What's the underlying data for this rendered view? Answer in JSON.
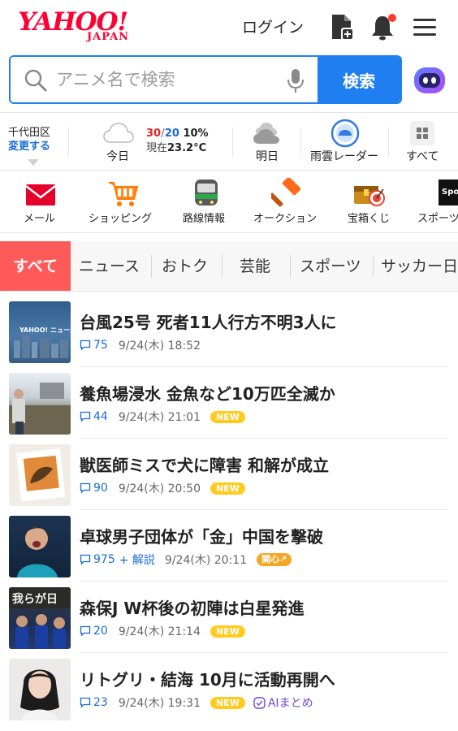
{
  "header": {
    "logo_main": "YAHOO!",
    "logo_sub": "JAPAN",
    "login_label": "ログイン",
    "icons": [
      "add-file-icon",
      "bell-icon",
      "menu-icon"
    ]
  },
  "search": {
    "placeholder": "アニメ名で検索",
    "button_label": "検索"
  },
  "weather": {
    "location": "千代田区",
    "change_label": "変更する",
    "today_label": "今日",
    "high": "30",
    "low": "20",
    "slash": "/",
    "rain": "10%",
    "now_prefix": "現在",
    "now_temp": "23.2°C",
    "tomorrow_label": "明日",
    "radar_label": "雨雲レーダー",
    "all_label": "すべて"
  },
  "services": [
    {
      "label": "メール",
      "icon": "mail-icon"
    },
    {
      "label": "ショッピング",
      "icon": "cart-icon"
    },
    {
      "label": "路線情報",
      "icon": "train-icon"
    },
    {
      "label": "オークション",
      "icon": "hammer-icon"
    },
    {
      "label": "宝箱くじ",
      "icon": "treasure-icon"
    },
    {
      "label": "スポーツ",
      "icon": "sports-icon"
    }
  ],
  "sports_logo_text": "Spor",
  "tabs": [
    "すべて",
    "ニュース",
    "おトク",
    "芸能",
    "スポーツ",
    "サッカー日"
  ],
  "news": [
    {
      "title": "台風25号 死者11人行方不明3人に",
      "comments": "75",
      "date": "9/24(木) 18:52",
      "badge": "",
      "thumb_text": "YAHOO! ニュース"
    },
    {
      "title": "養魚場浸水 金魚など10万匹全滅か",
      "comments": "44",
      "date": "9/24(木) 21:01",
      "badge": "NEW"
    },
    {
      "title": "獣医師ミスで犬に障害 和解が成立",
      "comments": "90",
      "date": "9/24(木) 20:50",
      "badge": "NEW"
    },
    {
      "title": "卓球男子団体が「金」中国を撃破",
      "comments": "975",
      "comments_extra": "+ 解説",
      "date": "9/24(木) 20:11",
      "badge": "関心",
      "badge_arrow": "↗"
    },
    {
      "title": "森保J W杯後の初陣は白星発進",
      "comments": "20",
      "date": "9/24(木) 21:14",
      "badge": "NEW",
      "thumb_text": "我らが日"
    },
    {
      "title": "リトグリ・結海 10月に活動再開へ",
      "comments": "23",
      "date": "9/24(木) 19:31",
      "badge": "NEW",
      "ai_label": "AIまとめ"
    }
  ]
}
